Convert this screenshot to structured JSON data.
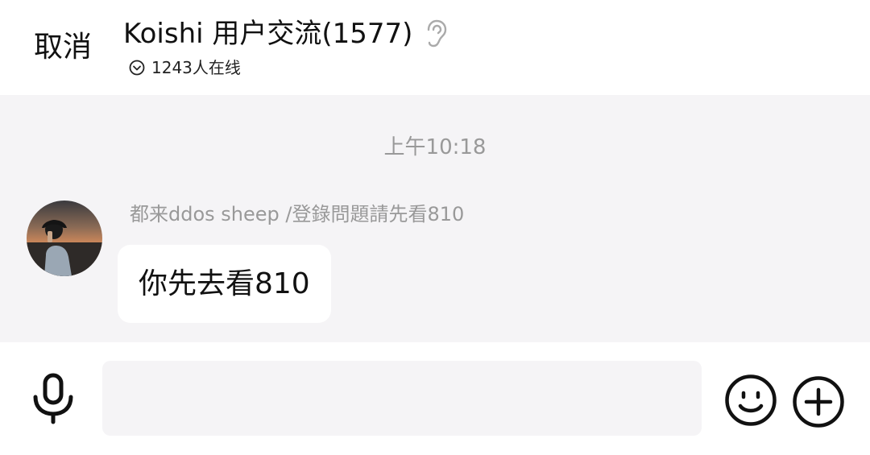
{
  "header": {
    "cancel_label": "取消",
    "group_title": "Koishi 用户交流(1577)",
    "online_text": "1243人在线",
    "ear_icon": "ear-icon",
    "online_icon": "chevron-down-circle-icon"
  },
  "chat": {
    "timestamp": "上午10:18",
    "messages": [
      {
        "sender": "都来ddos sheep /登錄問題請先看810",
        "text": "你先去看810",
        "avatar": "avatar-photo"
      }
    ]
  },
  "input_bar": {
    "placeholder": "",
    "mic_icon": "microphone-icon",
    "emoji_icon": "smiley-icon",
    "plus_icon": "plus-circle-icon"
  },
  "colors": {
    "chat_background": "#f5f4f6",
    "secondary_text": "#999999",
    "primary_text": "#111111"
  }
}
